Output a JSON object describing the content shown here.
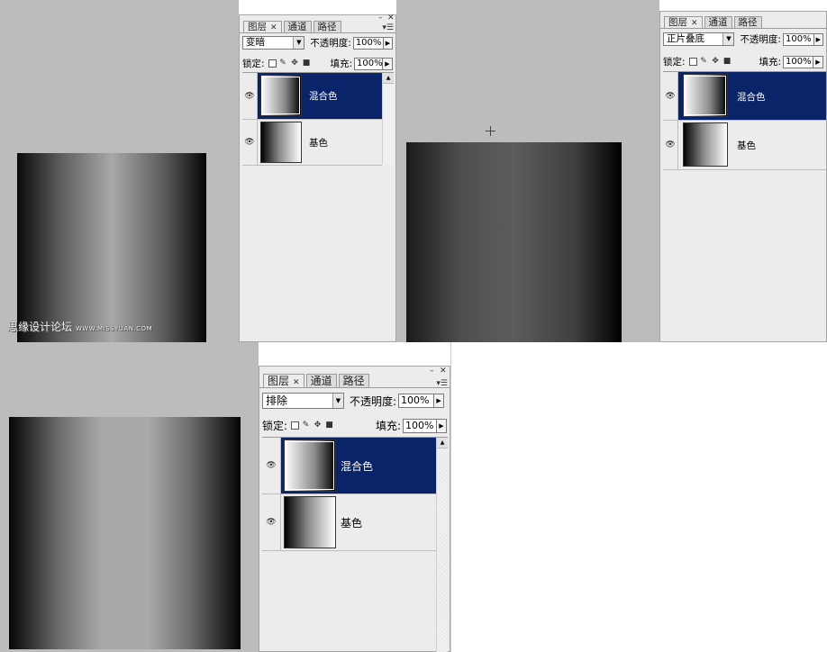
{
  "colors": {
    "highlight": "#0a246a",
    "workspace": "#bcbcbc",
    "panel": "#ececec"
  },
  "watermark": {
    "cn": "思缘设计论坛",
    "en": "WWW.MISSYUAN.COM"
  },
  "panels": [
    {
      "tabs": [
        "图层",
        "通道",
        "路径"
      ],
      "blend_mode": "变暗",
      "opacity_label": "不透明度:",
      "opacity_value": "100%",
      "lock_label": "锁定:",
      "fill_label": "填充:",
      "fill_value": "100%",
      "layers": [
        {
          "name": "混合色",
          "selected": true
        },
        {
          "name": "基色",
          "selected": false
        }
      ]
    },
    {
      "tabs": [
        "图层",
        "通道",
        "路径"
      ],
      "blend_mode": "正片叠底",
      "opacity_label": "不透明度:",
      "opacity_value": "100%",
      "lock_label": "锁定:",
      "fill_label": "填充:",
      "fill_value": "100%",
      "layers": [
        {
          "name": "混合色",
          "selected": true
        },
        {
          "name": "基色",
          "selected": false
        }
      ]
    },
    {
      "tabs": [
        "图层",
        "通道",
        "路径"
      ],
      "blend_mode": "排除",
      "opacity_label": "不透明度:",
      "opacity_value": "100%",
      "lock_label": "锁定:",
      "fill_label": "填充:",
      "fill_value": "100%",
      "layers": [
        {
          "name": "混合色",
          "selected": true
        },
        {
          "name": "基色",
          "selected": false
        }
      ]
    }
  ]
}
